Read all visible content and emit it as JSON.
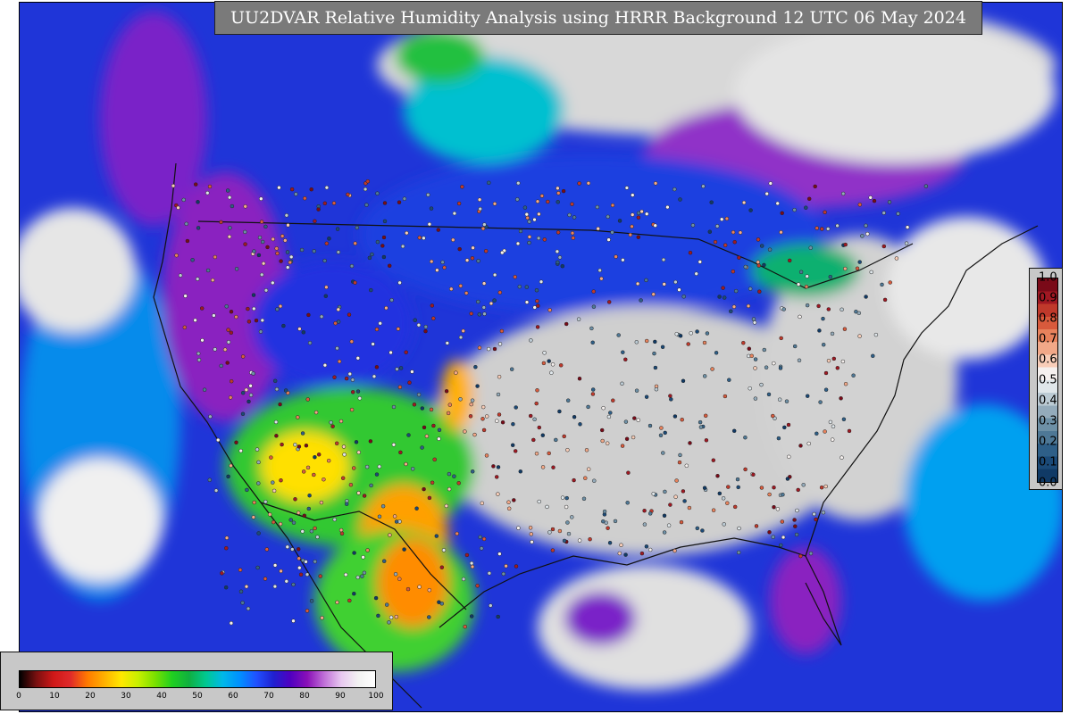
{
  "title": "UU2DVAR Relative Humidity Analysis using HRRR Background 12 UTC 06 May 2024",
  "legend_rh": {
    "ticks": [
      "0",
      "10",
      "20",
      "30",
      "40",
      "50",
      "60",
      "70",
      "80",
      "90",
      "100"
    ],
    "colors": [
      "#000000",
      "#7a1010",
      "#d01818",
      "#e02a2a",
      "#ff7a00",
      "#ffb000",
      "#ffe800",
      "#c8f000",
      "#7ae000",
      "#20d020",
      "#10b040",
      "#00c890",
      "#00b8e8",
      "#0090ff",
      "#2050ff",
      "#2020d0",
      "#5000c0",
      "#8a10b8",
      "#c070d8",
      "#e8c8f0",
      "#f2f2f2",
      "#ffffff"
    ]
  },
  "legend_obs": {
    "ticks": [
      "1.0",
      "0.9",
      "0.8",
      "0.7",
      "0.6",
      "0.5",
      "0.4",
      "0.3",
      "0.2",
      "0.1",
      "0.0"
    ],
    "colors": [
      "#7a0a18",
      "#a01822",
      "#c0392b",
      "#d85a3c",
      "#e8825c",
      "#f2a888",
      "#f8cdb8",
      "#f5f0ee",
      "#dfe6ea",
      "#bccbd4",
      "#94abbb",
      "#6d90a6",
      "#4e7896",
      "#2e5f88",
      "#1b4a78",
      "#103a66"
    ]
  },
  "palette": {
    "ocean": "#1f35d8",
    "land_dry": "#cfcfcf",
    "purple": "#8a18c0",
    "cyan": "#00b8e8",
    "green": "#20c020",
    "yellow": "#ffe000",
    "orange": "#ff9000",
    "border": "#111111"
  }
}
